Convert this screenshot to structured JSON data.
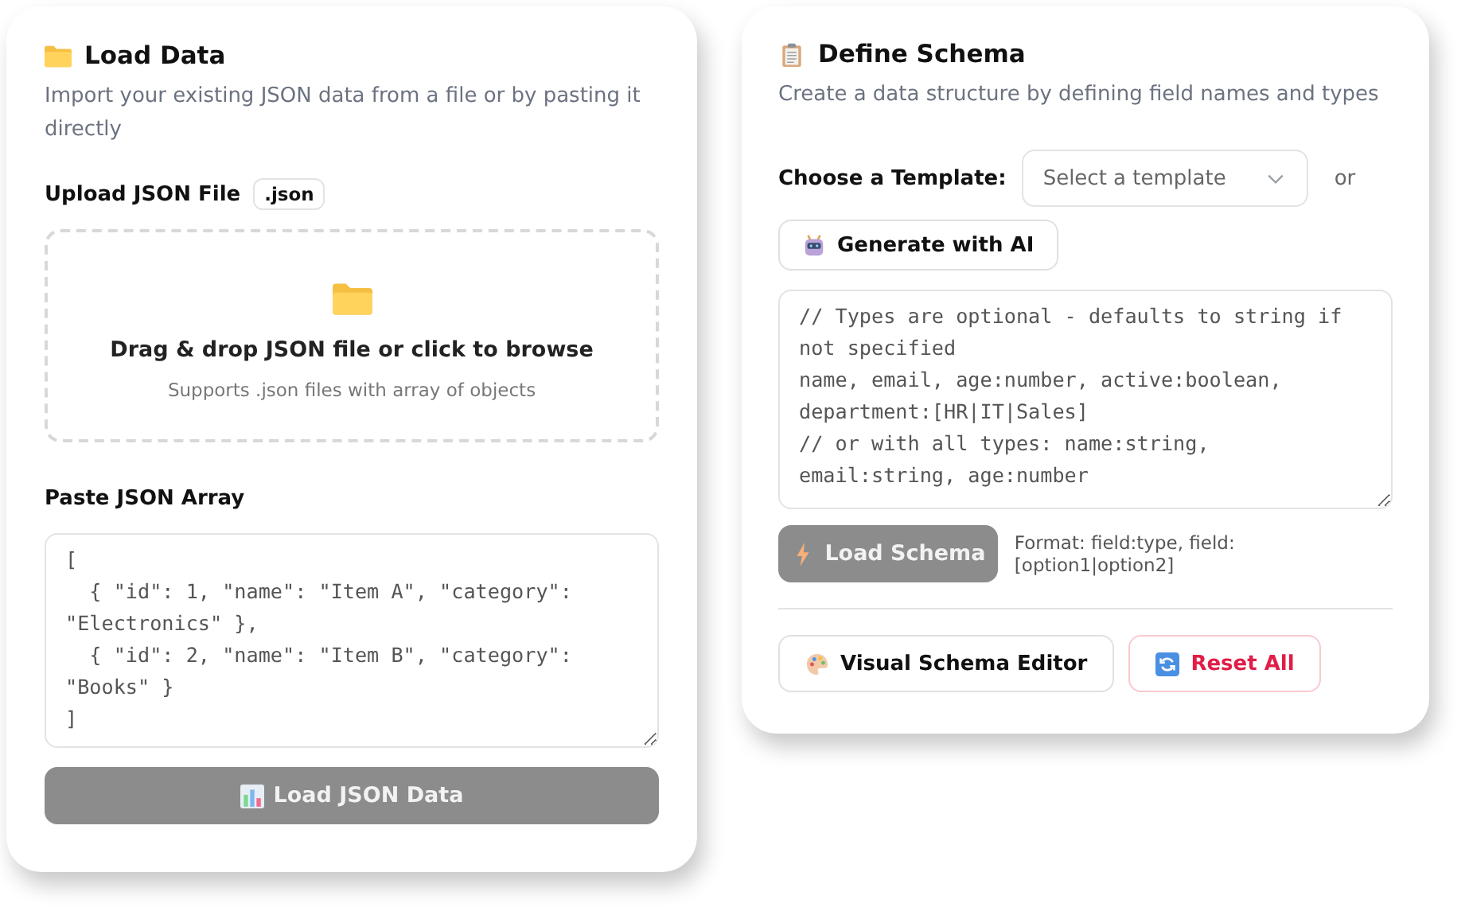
{
  "load_panel": {
    "title": "Load Data",
    "description": "Import your existing JSON data from a file or by pasting it directly",
    "upload_label": "Upload JSON File",
    "file_type_badge": ".json",
    "dropzone": {
      "title": "Drag & drop JSON file or click to browse",
      "hint": "Supports .json files with array of objects"
    },
    "paste_label": "Paste JSON Array",
    "json_input": {
      "value": "[\n  { \"id\": 1, \"name\": \"Item A\", \"category\": \"Electronics\" },\n  { \"id\": 2, \"name\": \"Item B\", \"category\": \"Books\" }\n]"
    },
    "load_button": {
      "label": "Load JSON Data",
      "disabled": true
    }
  },
  "schema_panel": {
    "title": "Define Schema",
    "description": "Create a data structure by defining field names and types",
    "template_label": "Choose a Template:",
    "template_select": {
      "value": "Select a template"
    },
    "or_text": "or",
    "ai_button": "Generate with AI",
    "schema_input": {
      "value": "// Types are optional - defaults to string if not specified\nname, email, age:number, active:boolean, department:[HR|IT|Sales]\n// or with all types: name:string, email:string, age:number"
    },
    "load_button": {
      "label": "Load Schema",
      "disabled": true
    },
    "format_hint": "Format: field:type, field:[option1|option2]",
    "visual_editor_button": "Visual Schema Editor",
    "reset_button": "Reset All"
  }
}
